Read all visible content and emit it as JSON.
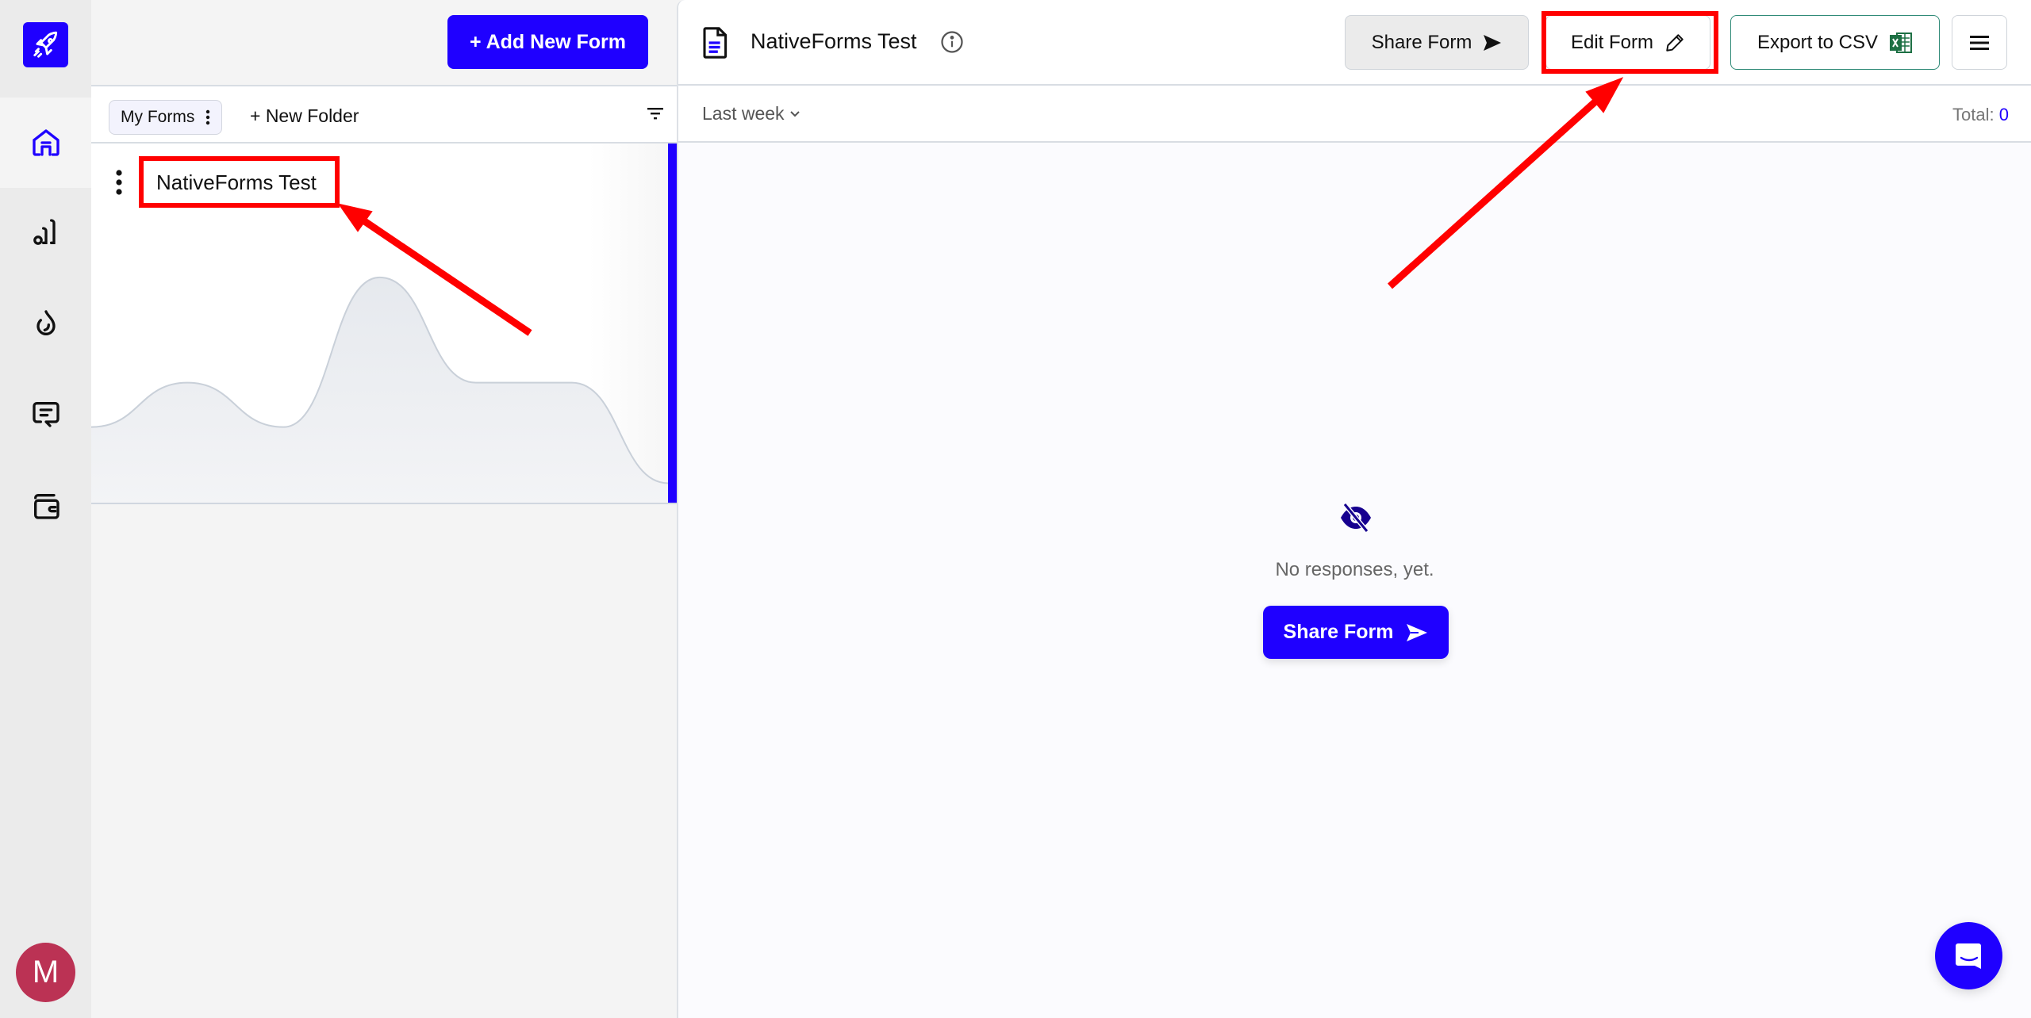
{
  "sidebar": {
    "logo_icon": "rocket-icon",
    "items": [
      {
        "name": "home",
        "icon": "home-icon",
        "active": true
      },
      {
        "name": "analytics",
        "icon": "analytics-icon",
        "active": false
      },
      {
        "name": "integrations",
        "icon": "drop-icon",
        "active": false
      },
      {
        "name": "messages",
        "icon": "message-icon",
        "active": false
      },
      {
        "name": "billing",
        "icon": "wallet-icon",
        "active": false
      }
    ],
    "avatar_initial": "M"
  },
  "list_panel": {
    "add_button_label": "+ Add New Form",
    "folder_chip_label": "My Forms",
    "new_folder_label": "+ New Folder",
    "forms": [
      {
        "title": "NativeForms Test"
      }
    ]
  },
  "main": {
    "form_title": "NativeForms Test",
    "buttons": {
      "share": "Share Form",
      "edit": "Edit Form",
      "export": "Export to CSV"
    },
    "date_range": "Last week",
    "total_label": "Total:",
    "total_value": "0",
    "empty_text": "No responses, yet.",
    "share_cta": "Share Form"
  },
  "colors": {
    "accent": "#1f00ff",
    "avatar": "#bb3254",
    "annotation": "#ff0000",
    "excel_green": "#1d7044"
  },
  "chart_data": {
    "type": "area",
    "title": "",
    "note": "decorative sparkline on form card, no axes",
    "values": [
      0.33,
      0.52,
      0.33,
      0.97,
      0.52,
      0.52,
      0.09
    ]
  }
}
